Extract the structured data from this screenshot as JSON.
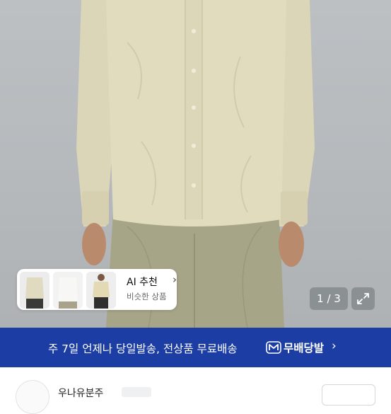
{
  "product_image": {
    "subject": "model-wearing-shirt",
    "shirt_color": "#e2dcbf",
    "pants_color": "#a7a588"
  },
  "similar": {
    "thumbnails": [
      "shirt-front-view",
      "shirt-flat-view",
      "model-full-view"
    ],
    "title": "AI 추천",
    "subtitle": "비슷한 상품",
    "chevron_icon": "chevron-right-icon"
  },
  "gallery": {
    "page_label": "1 / 3",
    "expand_icon": "expand-icon"
  },
  "banner": {
    "text": "주 7일 언제나 당일발송, 전상품 무료배송",
    "badge_icon": "m-badge-icon",
    "brand": "무배당발",
    "chevron_icon": "chevron-right-icon",
    "background": "#1c3da3"
  },
  "shop": {
    "name": "우나유분주"
  }
}
